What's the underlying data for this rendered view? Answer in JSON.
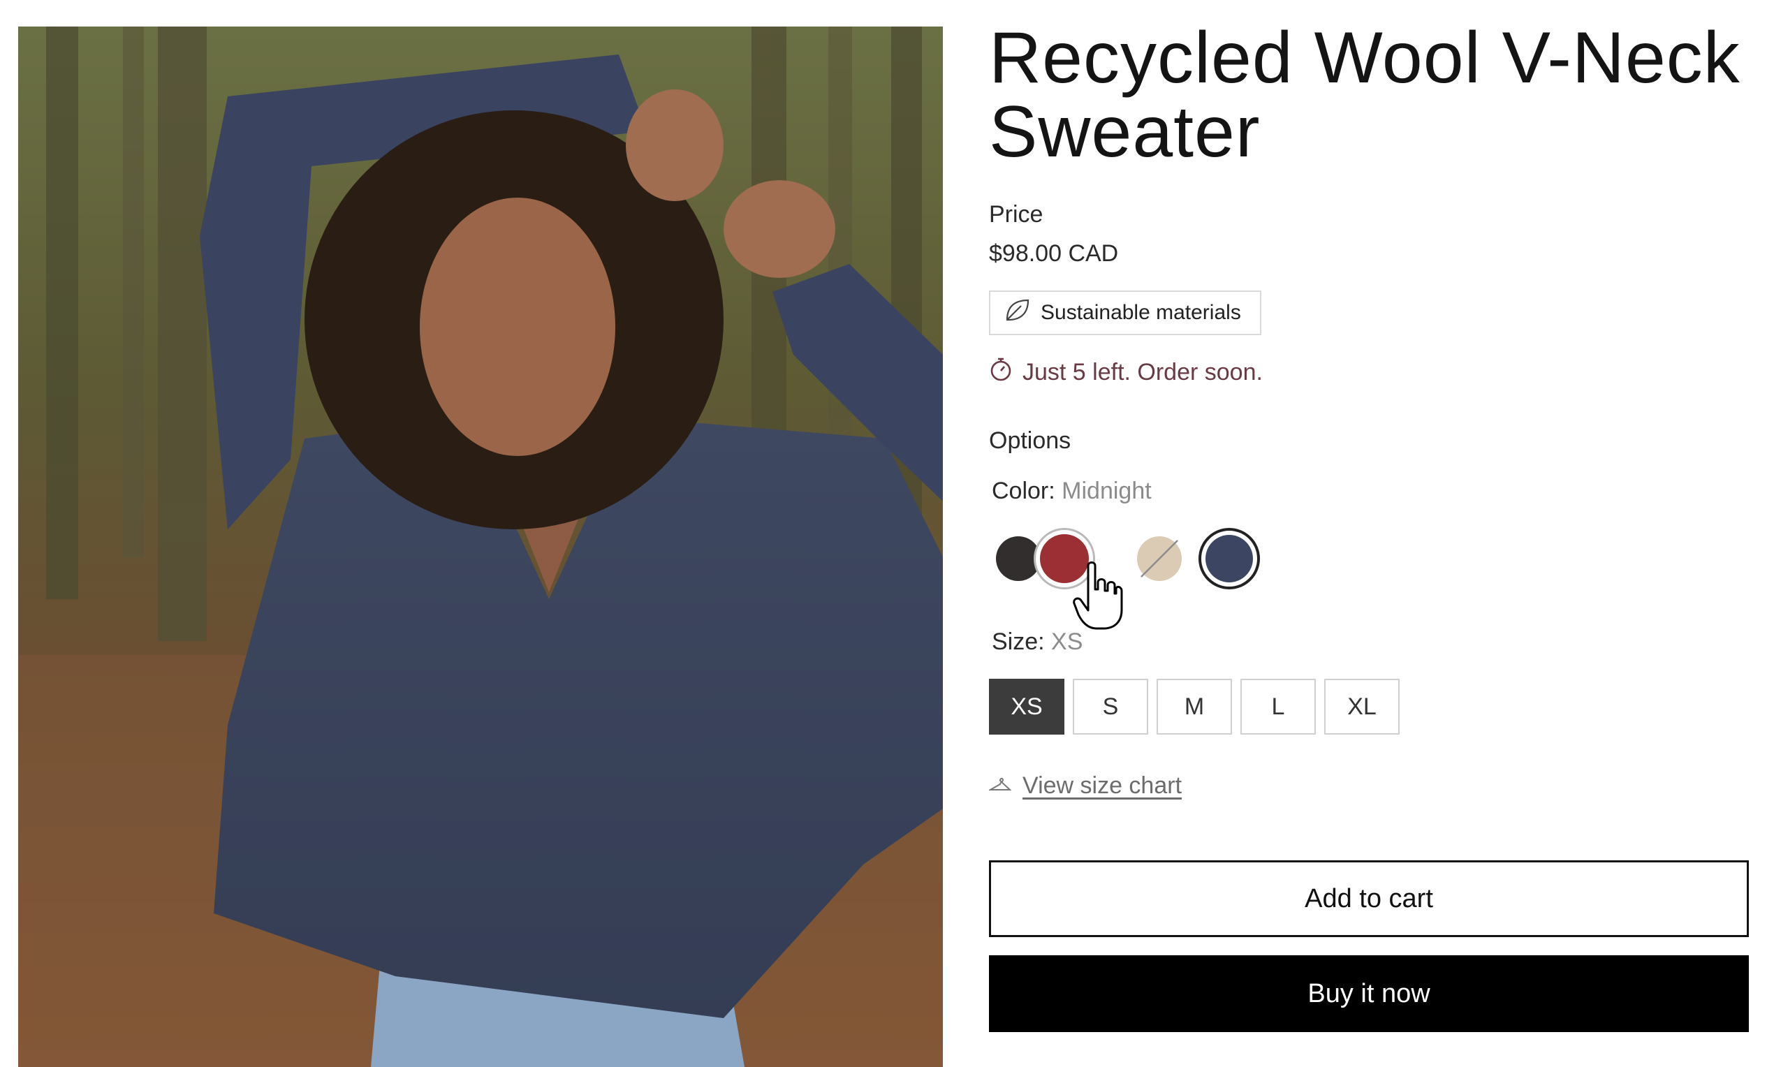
{
  "product": {
    "title": "Recycled Wool V-Neck Sweater",
    "price_label": "Price",
    "price": "$98.00 CAD",
    "badge": "Sustainable materials",
    "stock_notice": "Just 5 left. Order soon."
  },
  "options": {
    "heading": "Options",
    "color": {
      "label": "Color:",
      "selected": "Midnight",
      "swatches": [
        {
          "hex": "#332e2e",
          "state": "available"
        },
        {
          "hex": "#9b2f34",
          "state": "hovered"
        },
        {
          "hex": "#dccbb4",
          "state": "sold-out"
        },
        {
          "hex": "#3c4562",
          "state": "selected"
        }
      ]
    },
    "size": {
      "label": "Size:",
      "selected": "XS",
      "values": [
        "XS",
        "S",
        "M",
        "L",
        "XL"
      ]
    },
    "size_chart_link": "View size chart"
  },
  "actions": {
    "add_to_cart": "Add to cart",
    "buy_now": "Buy it now"
  },
  "colors": {
    "accent_stock": "#6a3a44",
    "primary_button": "#000000",
    "selected_size": "#3c3c3c"
  }
}
